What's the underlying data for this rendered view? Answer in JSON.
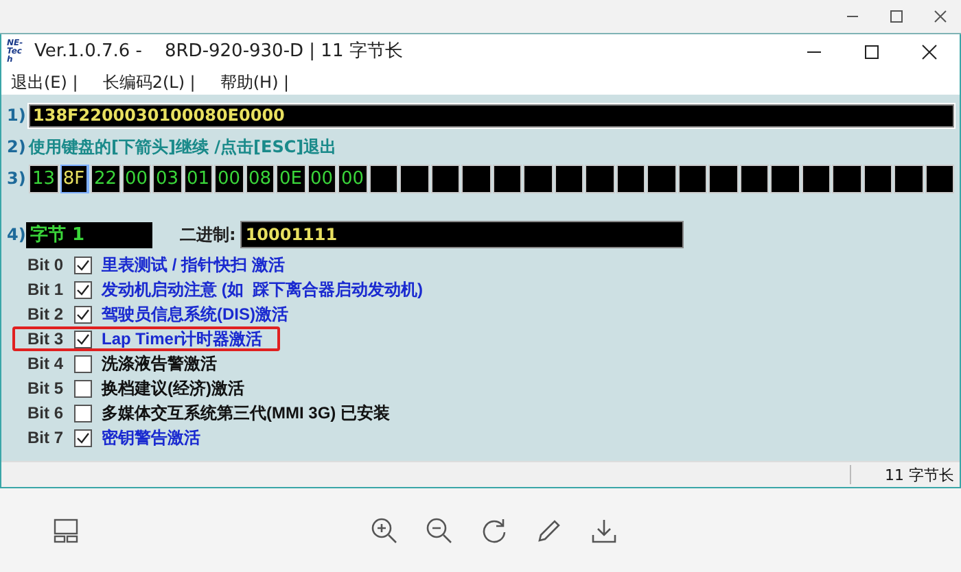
{
  "window": {
    "title": "Ver.1.0.7.6 -    8RD-920-930-D | 11 字节长",
    "logo": "NE-Tech"
  },
  "menu": [
    {
      "label": "退出(E) |"
    },
    {
      "label": "长编码2(L) |"
    },
    {
      "label": "帮助(H) |"
    }
  ],
  "row1": {
    "label": "1)",
    "value": "138F2200030100080E0000"
  },
  "row2": {
    "label": "2)",
    "text": "使用键盘的[下箭头]继续 /点击[ESC]退出"
  },
  "row3": {
    "label": "3)",
    "cells": [
      {
        "value": "13",
        "selected": false
      },
      {
        "value": "8F",
        "selected": true
      },
      {
        "value": "22",
        "selected": false
      },
      {
        "value": "00",
        "selected": false
      },
      {
        "value": "03",
        "selected": false
      },
      {
        "value": "01",
        "selected": false
      },
      {
        "value": "00",
        "selected": false
      },
      {
        "value": "08",
        "selected": false
      },
      {
        "value": "0E",
        "selected": false
      },
      {
        "value": "00",
        "selected": false
      },
      {
        "value": "00",
        "selected": false
      }
    ]
  },
  "row4": {
    "label": "4)",
    "byte": "字节 1",
    "binary_label": "二进制:",
    "binary": "10001111"
  },
  "bits": [
    {
      "label": "Bit 0",
      "text": "里表测试 / 指针快扫 激活",
      "checked": true,
      "highlighted": false
    },
    {
      "label": "Bit 1",
      "text": "发动机启动注意 (如  踩下离合器启动发动机)",
      "checked": true,
      "highlighted": false
    },
    {
      "label": "Bit 2",
      "text": "驾驶员信息系统(DIS)激活",
      "checked": true,
      "highlighted": false
    },
    {
      "label": "Bit 3",
      "text": "Lap Timer计时器激活",
      "checked": true,
      "highlighted": true
    },
    {
      "label": "Bit 4",
      "text": "洗涤液告警激活",
      "checked": false,
      "highlighted": false
    },
    {
      "label": "Bit 5",
      "text": "换档建议(经济)激活",
      "checked": false,
      "highlighted": false
    },
    {
      "label": "Bit 6",
      "text": "多媒体交互系统第三代(MMI 3G) 已安装",
      "checked": false,
      "highlighted": false
    },
    {
      "label": "Bit 7",
      "text": "密钥警告激活",
      "checked": true,
      "highlighted": false
    }
  ],
  "status_bar": {
    "text": "11 字节长"
  }
}
